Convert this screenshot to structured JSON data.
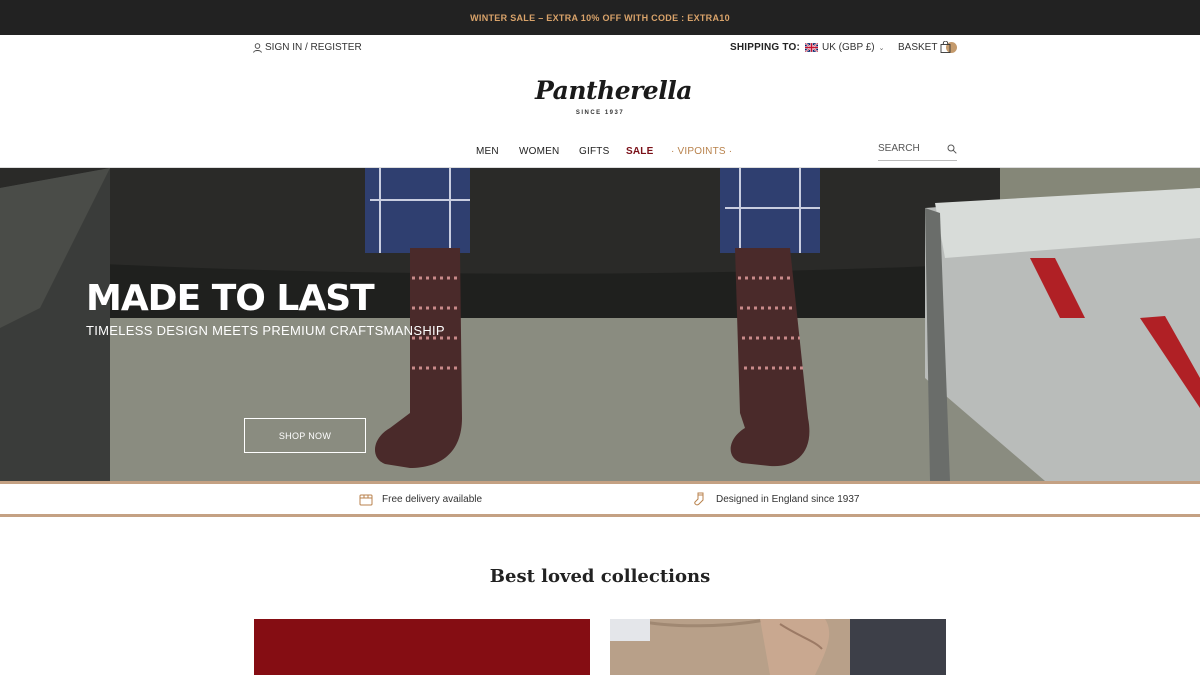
{
  "promo_bar": {
    "text": "WINTER SALE – EXTRA 10% OFF WITH CODE : EXTRA10"
  },
  "utility": {
    "signin_label": "SIGN IN / REGISTER",
    "shipping_label": "SHIPPING TO:",
    "currency_label": "UK (GBP £)",
    "basket_label": "BASKET"
  },
  "brand": {
    "name": "Pantherella",
    "tagline": "SINCE 1937"
  },
  "nav": {
    "items": [
      "MEN",
      "WOMEN",
      "GIFTS",
      "SALE"
    ],
    "vip_label": "· VIPOINTS ·",
    "search_placeholder": "SEARCH"
  },
  "hero": {
    "title": "MADE TO LAST",
    "subtitle": "TIMELESS DESIGN MEETS PREMIUM CRAFTSMANSHIP",
    "cta_label": "SHOP NOW"
  },
  "usps": [
    {
      "icon": "delivery-box-icon",
      "text": "Free delivery available"
    },
    {
      "icon": "sock-icon",
      "text": "Designed in England since 1937"
    }
  ],
  "collections": {
    "title": "Best loved collections"
  },
  "colors": {
    "promo_bg": "#222222",
    "promo_text": "#d9a36a",
    "sale": "#7a1018",
    "accent": "#c4a183",
    "card_red": "#850d13"
  }
}
